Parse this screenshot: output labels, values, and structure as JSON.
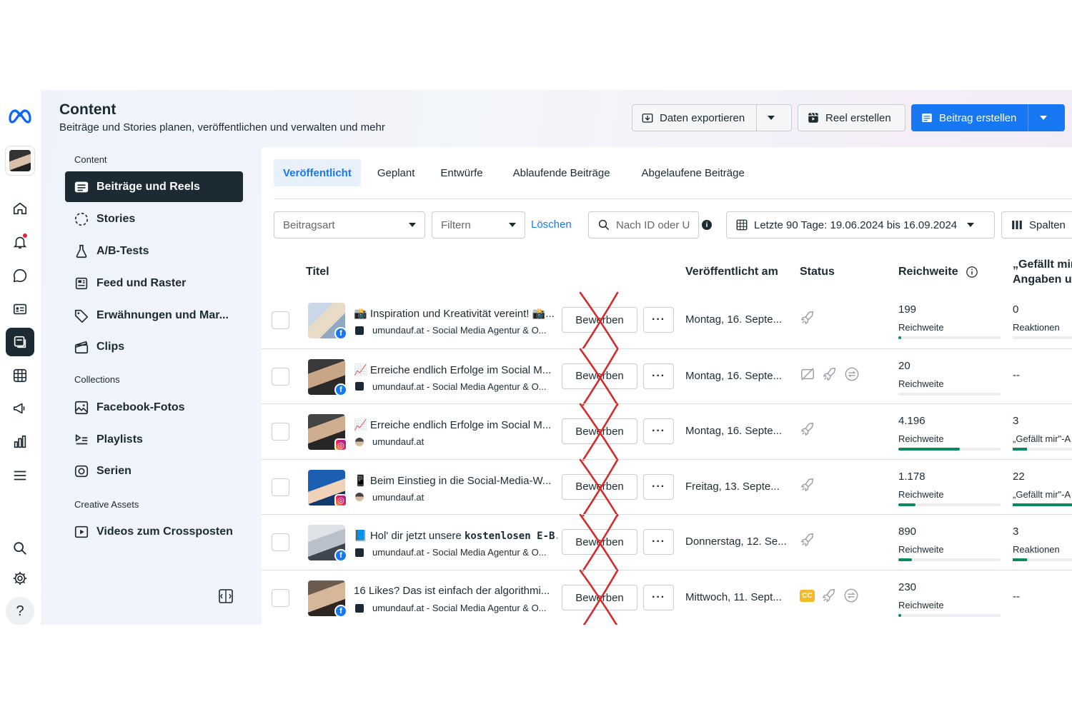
{
  "header": {
    "title": "Content",
    "subtitle": "Beiträge und Stories planen, veröffentlichen und verwalten und mehr",
    "export_label": "Daten exportieren",
    "reel_label": "Reel erstellen",
    "post_label": "Beitrag erstellen"
  },
  "sidebar": {
    "section_content": "Content",
    "section_collections": "Collections",
    "section_creative": "Creative Assets",
    "items": [
      {
        "label": "Beiträge und Reels"
      },
      {
        "label": "Stories"
      },
      {
        "label": "A/B-Tests"
      },
      {
        "label": "Feed und Raster"
      },
      {
        "label": "Erwähnungen und Mar..."
      },
      {
        "label": "Clips"
      },
      {
        "label": "Facebook-Fotos"
      },
      {
        "label": "Playlists"
      },
      {
        "label": "Serien"
      },
      {
        "label": "Videos zum Crossposten"
      }
    ]
  },
  "tabs": [
    "Veröffentlicht",
    "Geplant",
    "Entwürfe",
    "Ablaufende Beiträge",
    "Abgelaufene Beiträge"
  ],
  "filters": {
    "type_placeholder": "Beitragsart",
    "filter_placeholder": "Filtern",
    "clear_label": "Löschen",
    "search_placeholder": "Nach ID oder U",
    "date_range": "Letzte 90 Tage: 19.06.2024 bis 16.09.2024",
    "columns_label": "Spalten"
  },
  "table": {
    "headers": {
      "title": "Titel",
      "published": "Veröffentlicht am",
      "status": "Status",
      "reach": "Reichweite",
      "likes_line1": "„Gefällt mir\"-",
      "likes_line2": "Angaben und"
    },
    "boost_label": "Bewerben",
    "more_label": "···",
    "rows": [
      {
        "title": "📸 Inspiration und Kreativität vereint! 📸...",
        "title_bold": "",
        "account": "umundauf.at - Social Media Agentur & O...",
        "platform": "fb",
        "date": "Montag, 16. Septe...",
        "reach": "199",
        "reach_label": "Reichweite",
        "reach_fraction": 0.02,
        "likes": "0",
        "likes_label": "Reaktionen",
        "likes_fraction": 0,
        "status_icons": [
          "rocket-icon"
        ]
      },
      {
        "title": "📈 Erreiche endlich Erfolge im Social M...",
        "title_bold": "",
        "account": "umundauf.at - Social Media Agentur & O...",
        "platform": "fb",
        "date": "Montag, 16. Septe...",
        "reach": "20",
        "reach_label": "Reichweite",
        "reach_fraction": 0,
        "likes": "--",
        "likes_label": "",
        "likes_fraction": null,
        "status_icons": [
          "no-image-icon",
          "rocket-icon",
          "repeat-icon"
        ]
      },
      {
        "title": "📈 Erreiche endlich Erfolge im Social M...",
        "title_bold": "",
        "account": "umundauf.at",
        "platform": "ig",
        "date": "Montag, 16. Septe...",
        "reach": "4.196",
        "reach_label": "Reichweite",
        "reach_fraction": 0.6,
        "likes": "3",
        "likes_label": "„Gefällt mir\"-A",
        "likes_fraction": 0.2,
        "status_icons": [
          "rocket-icon"
        ]
      },
      {
        "title": "📱 Beim Einstieg in die Social-Media-W...",
        "title_bold": "",
        "account": "umundauf.at",
        "platform": "ig",
        "date": "Freitag, 13. Septe...",
        "reach": "1.178",
        "reach_label": "Reichweite",
        "reach_fraction": 0.17,
        "likes": "22",
        "likes_label": "„Gefällt mir\"-A",
        "likes_fraction": 0.9,
        "status_icons": [
          "rocket-icon"
        ]
      },
      {
        "title": "📘 Hol' dir jetzt unsere ",
        "title_bold": "kostenlosen E-B...",
        "account": "umundauf.at - Social Media Agentur & O...",
        "platform": "fb",
        "date": "Donnerstag, 12. Se...",
        "reach": "890",
        "reach_label": "Reichweite",
        "reach_fraction": 0.13,
        "likes": "3",
        "likes_label": "Reaktionen",
        "likes_fraction": 0.2,
        "status_icons": [
          "rocket-icon"
        ]
      },
      {
        "title": "16 Likes? Das ist einfach der algorithmi...",
        "title_bold": "",
        "account": "umundauf.at - Social Media Agentur & O...",
        "platform": "fb",
        "date": "Mittwoch, 11. Sept...",
        "reach": "230",
        "reach_label": "Reichweite",
        "reach_fraction": 0.02,
        "likes": "--",
        "likes_label": "",
        "likes_fraction": null,
        "status_icons": [
          "cc-icon",
          "rocket-icon",
          "repeat-icon"
        ]
      }
    ]
  },
  "colors": {
    "primary": "#1877f2",
    "dark": "#1c2b33",
    "progress": "#0a8a5f",
    "annotation": "#d42a2a"
  }
}
